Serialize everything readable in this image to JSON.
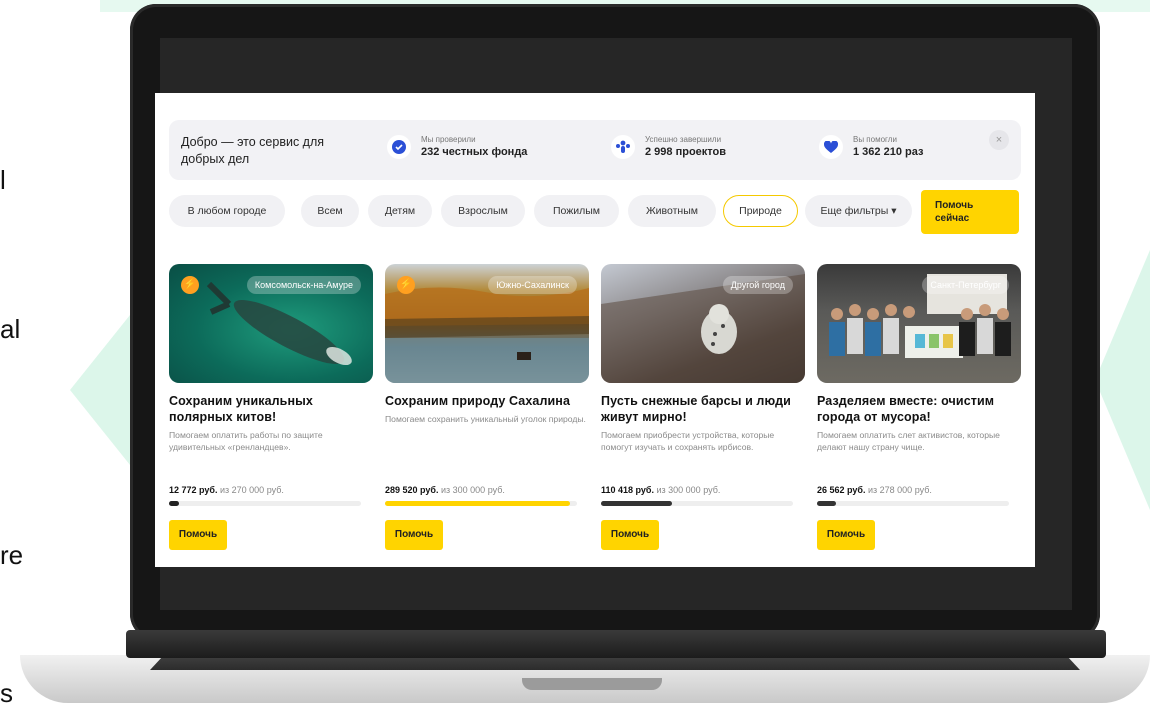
{
  "side_texts": [
    "l",
    "al",
    "re",
    "s"
  ],
  "stats_panel": {
    "tagline": "Добро — это сервис для добрых дел",
    "items": [
      {
        "small": "Мы проверили",
        "big": "232 честных фонда",
        "icon": "check-shield-icon"
      },
      {
        "small": "Успешно завершили",
        "big": "2 998 проектов",
        "icon": "people-icon"
      },
      {
        "small": "Вы помогли",
        "big": "1 362 210 раз",
        "icon": "heart-icon"
      }
    ],
    "close": "×"
  },
  "filters": {
    "city": "В любом городе",
    "chips": [
      "Всем",
      "Детям",
      "Взрослым",
      "Пожилым",
      "Животным",
      "Природе"
    ],
    "active": "Природе",
    "more": "Еще фильтры ▾",
    "help_now": "Помочь сейчас"
  },
  "cards": [
    {
      "city": "Комсомольск-на-Амуре",
      "urgent": true,
      "title": "Сохраним уникальных полярных китов!",
      "desc": "Помогаем оплатить работы по защите удивительных «гренландцев».",
      "raised": "12 772 руб.",
      "goal": "из 270 000 руб.",
      "progress": 0.05,
      "bar_color": "#222222",
      "button": "Помочь"
    },
    {
      "city": "Южно-Сахалинск",
      "urgent": true,
      "title": "Сохраним природу Сахалина",
      "desc": "Помогаем сохранить уникальный уголок природы.",
      "raised": "289 520 руб.",
      "goal": "из 300 000 руб.",
      "progress": 0.965,
      "bar_color": "#ffd400",
      "button": "Помочь"
    },
    {
      "city": "Другой город",
      "urgent": false,
      "title": "Пусть снежные барсы и люди живут мирно!",
      "desc": "Помогаем приобрести устройства, которые помогут изучать и сохранять ирбисов.",
      "raised": "110 418 руб.",
      "goal": "из 300 000 руб.",
      "progress": 0.37,
      "bar_color": "#333333",
      "button": "Помочь"
    },
    {
      "city": "Санкт-Петербург",
      "urgent": false,
      "title": "Разделяем вместе: очистим города от мусора!",
      "desc": "Помогаем оплатить слет активистов, которые делают нашу страну чище.",
      "raised": "26 562 руб.",
      "goal": "из 278 000 руб.",
      "progress": 0.1,
      "bar_color": "#333333",
      "button": "Помочь"
    }
  ],
  "colors": {
    "accent": "#ffd400",
    "bolt": "#ffa020",
    "background_shape": "#dcf6ea"
  }
}
